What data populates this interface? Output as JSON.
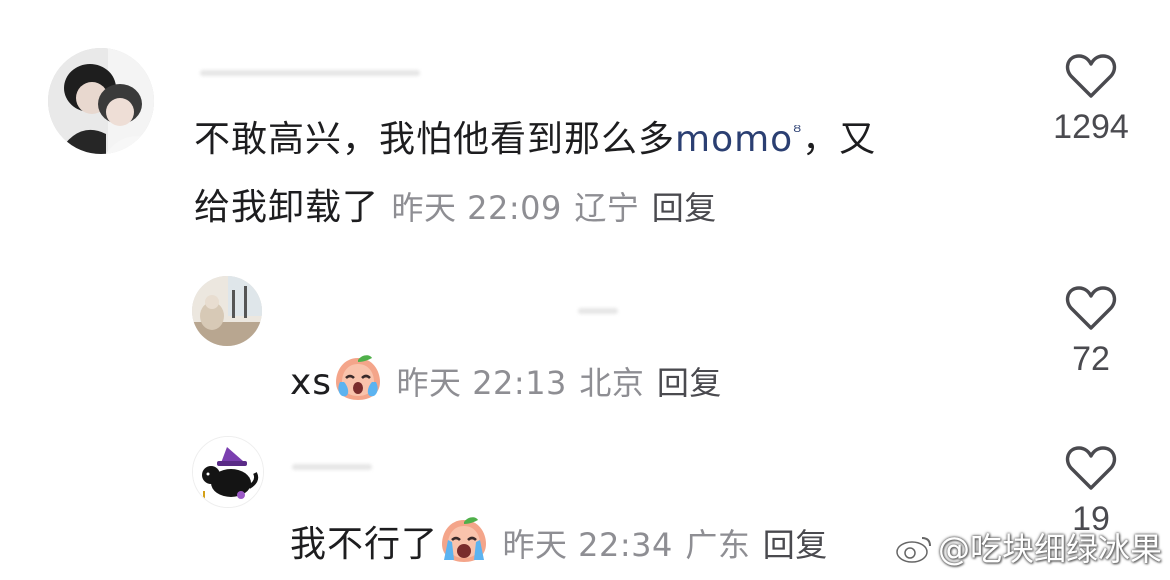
{
  "comments": [
    {
      "text_before": "不敢高兴，我怕他看到那么多",
      "mention": "momo",
      "text_after": "，又",
      "text_line2": "给我卸载了",
      "time": "昨天 22:09",
      "location": "辽宁",
      "reply_label": "回复",
      "likes": "1294"
    },
    {
      "text": "xs",
      "time": "昨天 22:13",
      "location": "北京",
      "reply_label": "回复",
      "likes": "72"
    },
    {
      "text": "我不行了",
      "time": "昨天 22:34",
      "location": "广东",
      "reply_label": "回复",
      "likes": "19"
    }
  ],
  "watermark": "@吃块细绿冰果",
  "icons": {
    "like": "heart-outline-icon",
    "mention_search": "search-icon",
    "emoji_reply1": "crying-peach-emoji",
    "emoji_reply2": "crying-peach-emoji"
  },
  "colors": {
    "text": "#1d1d1f",
    "meta": "#8e8e93",
    "mention": "#2b3f72"
  }
}
